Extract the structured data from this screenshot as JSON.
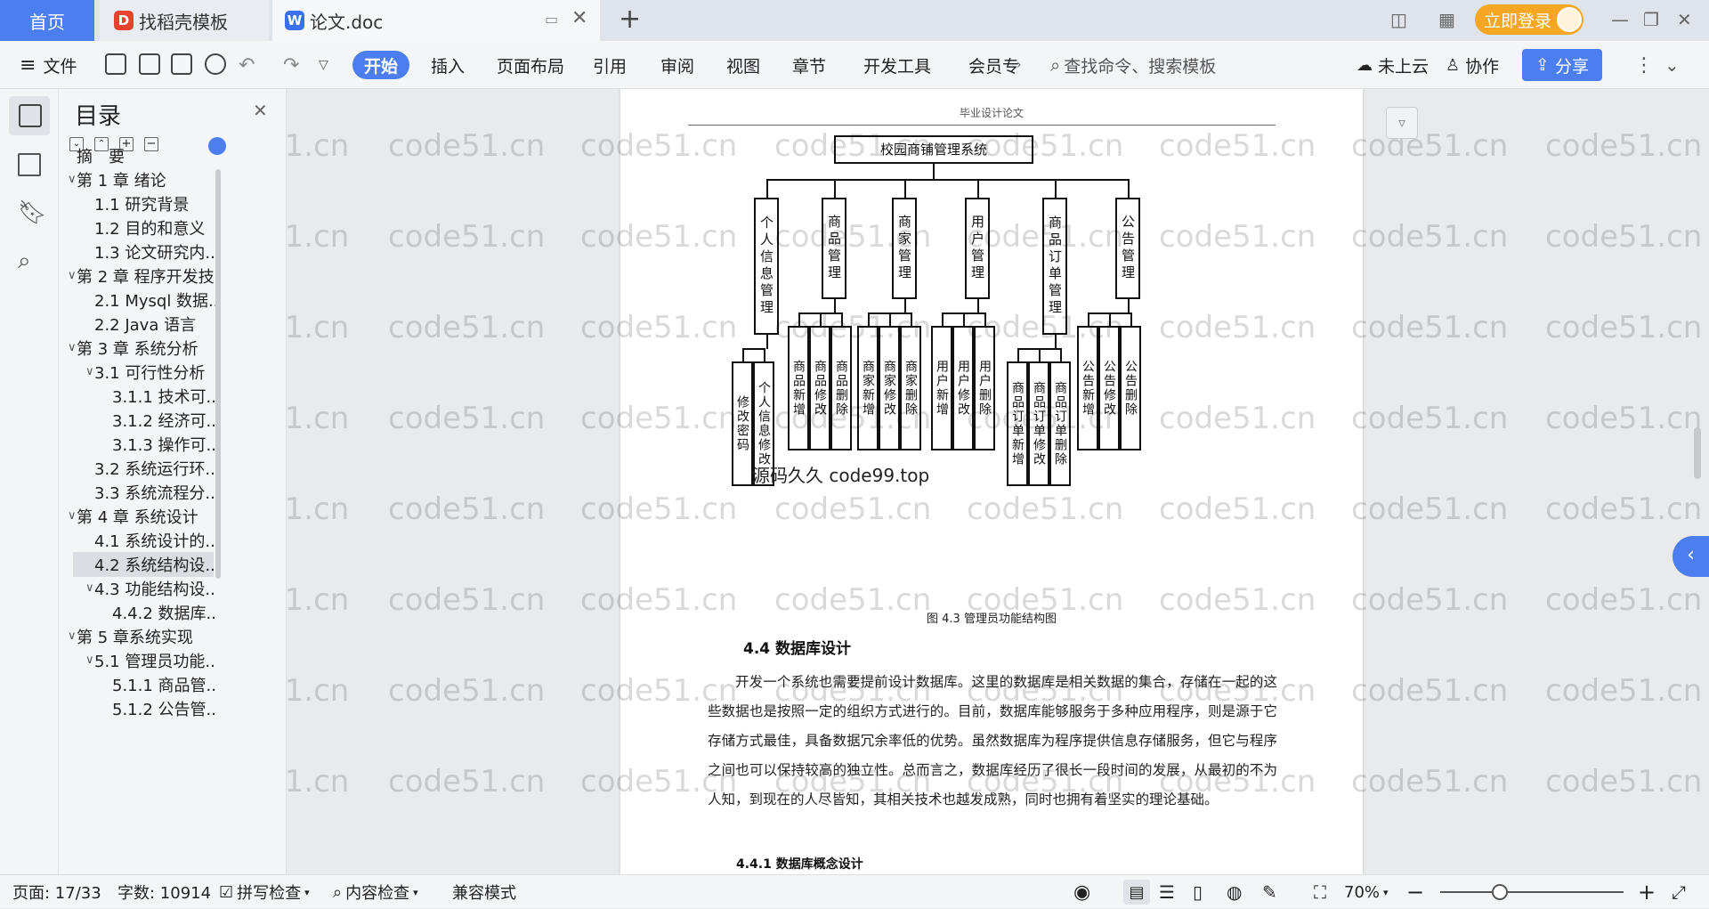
{
  "tabs": {
    "home": "首页",
    "docer": "找稻壳模板",
    "doc": "论文.doc"
  },
  "login": {
    "label": "立即登录"
  },
  "toolbar": {
    "file": "文件",
    "menus": [
      "开始",
      "插入",
      "页面布局",
      "引用",
      "审阅",
      "视图",
      "章节",
      "开发工具",
      "会员专"
    ],
    "search_placeholder": "查找命令、搜索模板",
    "cloud": "未上云",
    "collab": "协作",
    "share": "分享"
  },
  "toc": {
    "title": "目录",
    "items": [
      {
        "label": "摘　要",
        "level": 0,
        "arrow": false
      },
      {
        "label": "第 1 章  绪论",
        "level": 0,
        "arrow": true
      },
      {
        "label": "1.1  研究背景",
        "level": 1,
        "arrow": false
      },
      {
        "label": "1.2 目的和意义",
        "level": 1,
        "arrow": false
      },
      {
        "label": "1.3  论文研究内...",
        "level": 1,
        "arrow": false
      },
      {
        "label": "第 2 章  程序开发技...",
        "level": 0,
        "arrow": true
      },
      {
        "label": "2.1 Mysql 数据...",
        "level": 1,
        "arrow": false
      },
      {
        "label": "2.2 Java 语言",
        "level": 1,
        "arrow": false
      },
      {
        "label": "第 3 章  系统分析",
        "level": 0,
        "arrow": true
      },
      {
        "label": "3.1 可行性分析",
        "level": 1,
        "arrow": true
      },
      {
        "label": "3.1.1 技术可...",
        "level": 2,
        "arrow": false
      },
      {
        "label": "3.1.2 经济可...",
        "level": 2,
        "arrow": false
      },
      {
        "label": "3.1.3 操作可...",
        "level": 2,
        "arrow": false
      },
      {
        "label": "3.2 系统运行环...",
        "level": 1,
        "arrow": false
      },
      {
        "label": "3.3 系统流程分...",
        "level": 1,
        "arrow": false
      },
      {
        "label": "第 4 章  系统设计",
        "level": 0,
        "arrow": true
      },
      {
        "label": "4.1  系统设计的...",
        "level": 1,
        "arrow": false
      },
      {
        "label": "4.2  系统结构设...",
        "level": 1,
        "arrow": false,
        "selected": true
      },
      {
        "label": "4.3 功能结构设...",
        "level": 1,
        "arrow": true
      },
      {
        "label": "4.4.2  数据库...",
        "level": 2,
        "arrow": false
      },
      {
        "label": "第 5 章系统实现",
        "level": 0,
        "arrow": true
      },
      {
        "label": "5.1 管理员功能...",
        "level": 1,
        "arrow": true
      },
      {
        "label": "5.1.1  商品管...",
        "level": 2,
        "arrow": false
      },
      {
        "label": "5.1.2  公告管...",
        "level": 2,
        "arrow": false
      }
    ]
  },
  "document": {
    "header": "毕业设计论文",
    "diagram": {
      "root": "校园商铺管理系统",
      "modules": [
        {
          "name": "个人信息管理",
          "children": [
            "修改密码",
            "个人信息修改"
          ]
        },
        {
          "name": "商品管理",
          "children": [
            "商品新增",
            "商品修改",
            "商品删除"
          ]
        },
        {
          "name": "商家管理",
          "children": [
            "商家新增",
            "商家修改",
            "商家删除"
          ]
        },
        {
          "name": "用户管理",
          "children": [
            "用户新增",
            "用户修改",
            "用户删除"
          ]
        },
        {
          "name": "商品订单管理",
          "children": [
            "商品订单新增",
            "商品订单修改",
            "商品订单删除"
          ]
        },
        {
          "name": "公告管理",
          "children": [
            "公告新增",
            "公告修改",
            "公告删除"
          ]
        }
      ],
      "overlay": "源码久久 code99.top"
    },
    "caption": "图 4.3  管理员功能结构图",
    "section_title": "4.4  数据库设计",
    "paragraph": "开发一个系统也需要提前设计数据库。这里的数据库是相关数据的集合，存储在一起的这些数据也是按照一定的组织方式进行的。目前，数据库能够服务于多种应用程序，则是源于它存储方式最佳，具备数据冗余率低的优势。虽然数据库为程序提供信息存储服务，但它与程序之间也可以保持较高的独立性。总而言之，数据库经历了很长一段时间的发展，从最初的不为人知，到现在的人尽皆知，其相关技术也越发成熟，同时也拥有着坚实的理论基础。",
    "subsection_title": "4.4.1  数据库概念设计",
    "watermark": "code51.cn"
  },
  "status": {
    "page": "页面: 17/33",
    "words": "字数: 10914",
    "spell": "拼写检查",
    "content": "内容检查",
    "compat": "兼容模式",
    "zoom": "70%"
  }
}
